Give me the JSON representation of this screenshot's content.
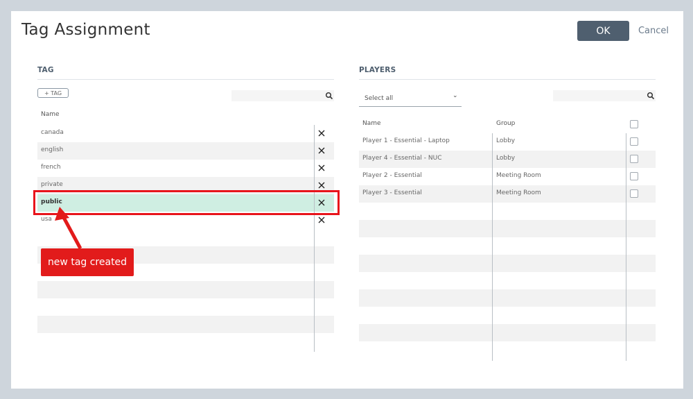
{
  "dialog": {
    "title": "Tag Assignment",
    "ok_label": "OK",
    "cancel_label": "Cancel"
  },
  "tag_panel": {
    "heading": "TAG",
    "add_button_label": "+ TAG",
    "search_icon": "search-icon",
    "column_name": "Name",
    "rows": [
      {
        "label": "canada",
        "selected": false
      },
      {
        "label": "english",
        "selected": false
      },
      {
        "label": "french",
        "selected": false
      },
      {
        "label": "private",
        "selected": false
      },
      {
        "label": "public",
        "selected": true
      },
      {
        "label": "usa",
        "selected": false
      }
    ],
    "delete_icon": "close-icon"
  },
  "players_panel": {
    "heading": "PLAYERS",
    "select_all_label": "Select all",
    "search_icon": "search-icon",
    "columns": [
      "Name",
      "Group"
    ],
    "rows": [
      {
        "name": "Player 1 - Essential - Laptop",
        "group": "Lobby"
      },
      {
        "name": "Player 4 - Essential - NUC",
        "group": "Lobby"
      },
      {
        "name": "Player 2 - Essential",
        "group": "Meeting Room"
      },
      {
        "name": "Player 3 - Essential",
        "group": "Meeting Room"
      }
    ]
  },
  "annotation": {
    "callout_text": "new tag created",
    "color": "#e21b1b"
  },
  "colors": {
    "ok_button": "#4f5f6f",
    "selected_row": "#cfeee2",
    "stripe": "#f2f2f2"
  }
}
